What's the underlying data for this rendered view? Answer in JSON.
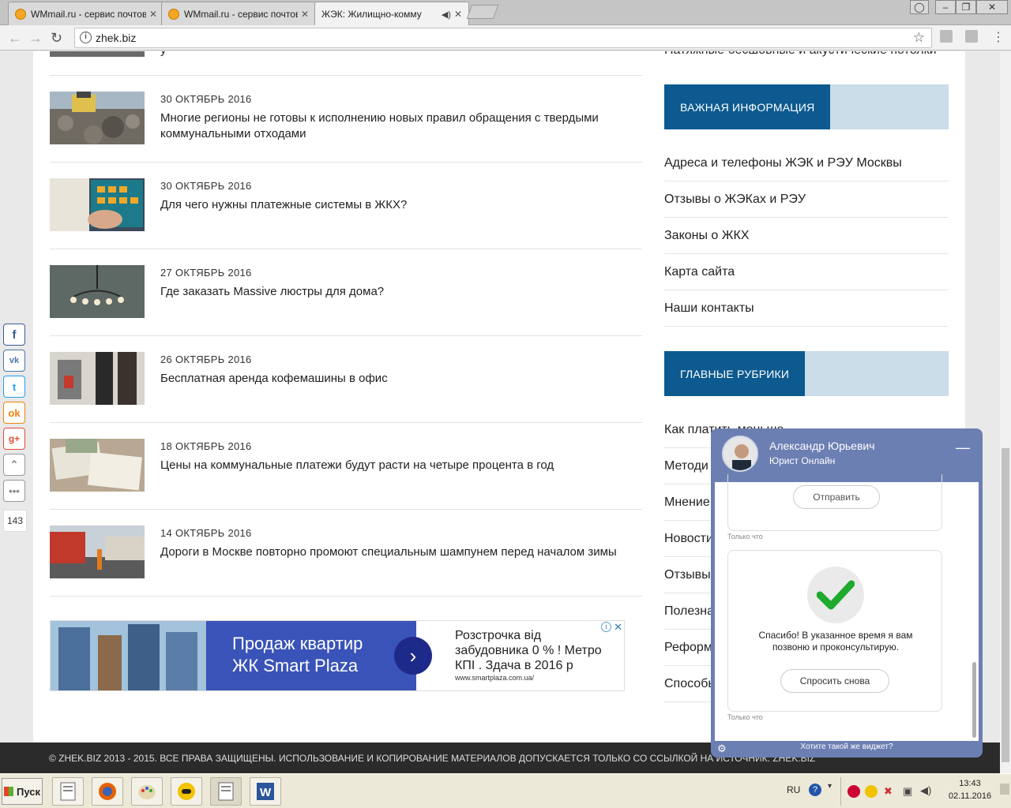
{
  "browser": {
    "tabs": [
      {
        "title": "WMmail.ru - сервис почтов"
      },
      {
        "title": "WMmail.ru - сервис почтов"
      },
      {
        "title": "ЖЭК: Жилищно-комму"
      }
    ],
    "url": "zhek.biz"
  },
  "top_partial": {
    "left_text": "у",
    "right_text": "Натяжные бесшовные и акустические потолки"
  },
  "news": [
    {
      "date": "30 ОКТЯБРЬ 2016",
      "title": "Многие регионы не готовы к исполнению новых правил обращения с твердыми коммунальными отходами"
    },
    {
      "date": "30 ОКТЯБРЬ 2016",
      "title": "Для чего нужны платежные системы в ЖКХ?"
    },
    {
      "date": "27 ОКТЯБРЬ 2016",
      "title": "Где заказать Massive люстры для дома?"
    },
    {
      "date": "26 ОКТЯБРЬ 2016",
      "title": "Бесплатная аренда кофемашины в офис"
    },
    {
      "date": "18 ОКТЯБРЬ 2016",
      "title": "Цены на коммунальные платежи будут расти на четыре процента в год"
    },
    {
      "date": "14 ОКТЯБРЬ 2016",
      "title": "Дороги в Москве повторно промоют специальным шампунем перед началом зимы"
    }
  ],
  "ad": {
    "headline_1": "Продаж квартир",
    "headline_2": "ЖК Smart Plaza",
    "body": "Розстрочка від забудовника 0 % ! Метро КПІ . Здача в 2016 р",
    "url": "www.smartplaza.com.ua/"
  },
  "sidebar": {
    "important_title": "ВАЖНАЯ ИНФОРМАЦИЯ",
    "important_links": [
      "Адреса и телефоны ЖЭК и РЭУ Москвы",
      "Отзывы о ЖЭКах и РЭУ",
      "Законы о ЖКХ",
      "Карта сайта",
      "Наши контакты"
    ],
    "rubrics_title": "ГЛАВНЫЕ РУБРИКИ",
    "rubric_links": [
      "Как платить меньше",
      "Методи",
      "Мнение",
      "Новости",
      "Отзывы",
      "Полезна",
      "Реформ",
      "Способы"
    ]
  },
  "social": {
    "count": "143"
  },
  "chat": {
    "agent_name": "Александр Юрьевич",
    "agent_role": "Юрист Онлайн",
    "send_label": "Отправить",
    "time_1": "Только что",
    "thanks_text": "Спасибо! В указанное время я вам позвоню и проконсультирую.",
    "ask_again_label": "Спросить снова",
    "time_2": "Только что",
    "widget_link": "Хотите такой же виджет?"
  },
  "footer": {
    "text": "© ZHEK.BIZ 2013 - 2015. ВСЕ ПРАВА ЗАЩИЩЕНЫ. ИСПОЛЬЗОВАНИЕ И КОПИРОВАНИЕ МАТЕРИАЛОВ ДОПУСКАЕТСЯ ТОЛЬКО СО ССЫЛКОЙ НА ИСТОЧНИК. ZHEK.BIZ"
  },
  "taskbar": {
    "start_label": "Пуск",
    "lang": "RU",
    "time": "13:43",
    "date": "02.11.2016"
  },
  "colors": {
    "accent_blue": "#0c5a8f",
    "accent_light": "#cadde8",
    "chat_header": "#6c7fb3",
    "check_green": "#1faa2e"
  }
}
